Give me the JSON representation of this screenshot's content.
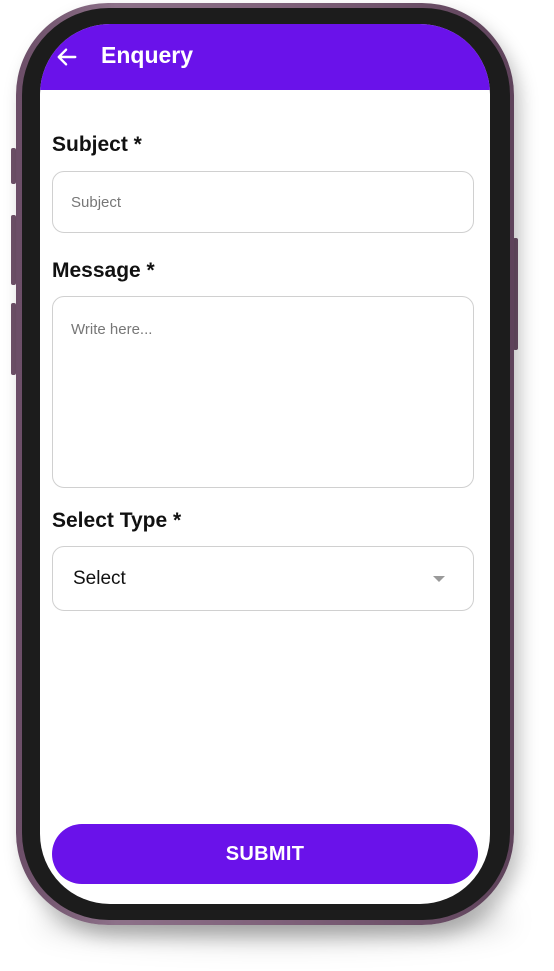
{
  "app_bar": {
    "title": "Enquery",
    "back_icon": "arrow-left-icon"
  },
  "form": {
    "subject": {
      "label": "Subject *",
      "placeholder": "Subject",
      "value": ""
    },
    "message": {
      "label": "Message *",
      "placeholder": "Write here...",
      "value": ""
    },
    "type": {
      "label": "Select Type *",
      "selected": "Select",
      "icon": "chevron-down-icon"
    },
    "submit_label": "SUBMIT"
  },
  "colors": {
    "primary": "#6a12ea",
    "frame": "#7e6079",
    "field_border": "#d0d0d0"
  }
}
